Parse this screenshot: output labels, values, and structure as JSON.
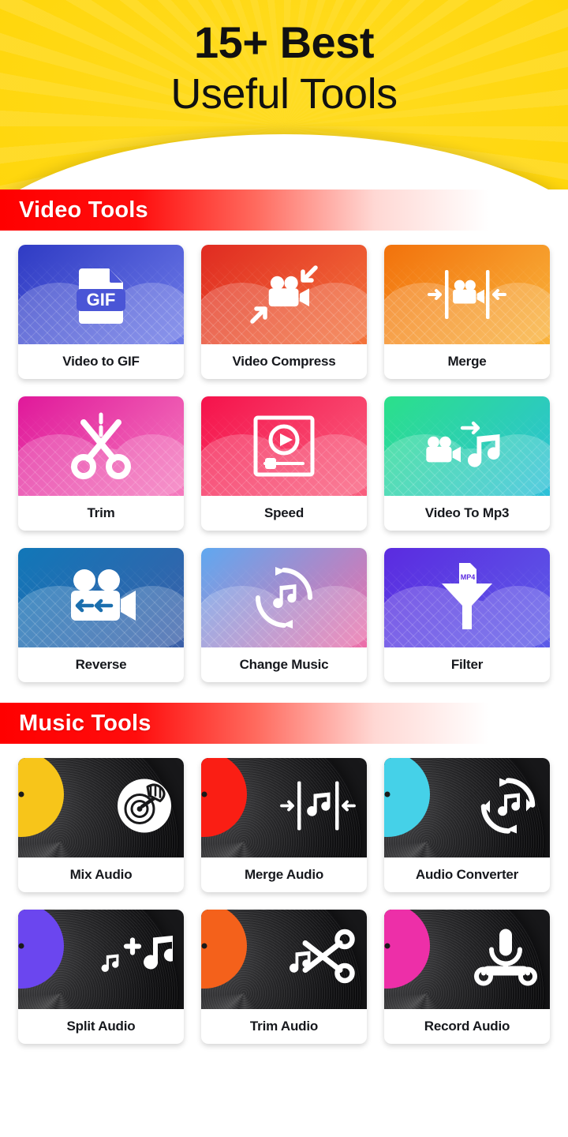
{
  "hero": {
    "line1": "15+ Best",
    "line2": "Useful Tools",
    "background_color": "#FFD60A",
    "text_color": "#111111"
  },
  "sections": [
    {
      "id": "video-tools",
      "title": "Video Tools",
      "bar_color": "#FF0000",
      "cards": [
        {
          "label": "Video to GIF",
          "icon": "gif-file-icon",
          "color_from": "#2F3BC4",
          "color_to": "#6E7BE8"
        },
        {
          "label": "Video Compress",
          "icon": "video-compress-icon",
          "color_from": "#E02B21",
          "color_to": "#F4743B"
        },
        {
          "label": "Merge",
          "icon": "video-merge-icon",
          "color_from": "#F2720C",
          "color_to": "#F9B43C"
        },
        {
          "label": "Trim",
          "icon": "scissors-icon",
          "color_from": "#E0189A",
          "color_to": "#F57BBE"
        },
        {
          "label": "Speed",
          "icon": "video-speed-icon",
          "color_from": "#F5124B",
          "color_to": "#F9607F"
        },
        {
          "label": "Video To Mp3",
          "icon": "video-to-audio-icon",
          "color_from": "#2BE08A",
          "color_to": "#2DBFD9"
        },
        {
          "label": "Reverse",
          "icon": "video-reverse-icon",
          "color_from": "#1177B8",
          "color_to": "#3C5FA8"
        },
        {
          "label": "Change Music",
          "icon": "change-music-icon",
          "color_from": "#5FA8F0",
          "color_to": "#EE6EA8"
        },
        {
          "label": "Filter",
          "icon": "mp4-funnel-filter-icon",
          "color_from": "#5B2BE0",
          "color_to": "#5C5CE8"
        }
      ]
    },
    {
      "id": "music-tools",
      "title": "Music Tools",
      "bar_color": "#FF0000",
      "cards": [
        {
          "label": "Mix Audio",
          "icon": "dj-hand-scratch-icon",
          "label_color": "#F7C51A"
        },
        {
          "label": "Merge Audio",
          "icon": "merge-audio-icon",
          "label_color": "#FA1E14"
        },
        {
          "label": "Audio Converter",
          "icon": "audio-convert-icon",
          "label_color": "#45D1E8"
        },
        {
          "label": "Split Audio",
          "icon": "split-audio-icon",
          "label_color": "#6B46EF"
        },
        {
          "label": "Trim Audio",
          "icon": "trim-audio-icon",
          "label_color": "#F4611B"
        },
        {
          "label": "Record Audio",
          "icon": "microphone-icon",
          "label_color": "#ED2FA8"
        }
      ]
    }
  ]
}
